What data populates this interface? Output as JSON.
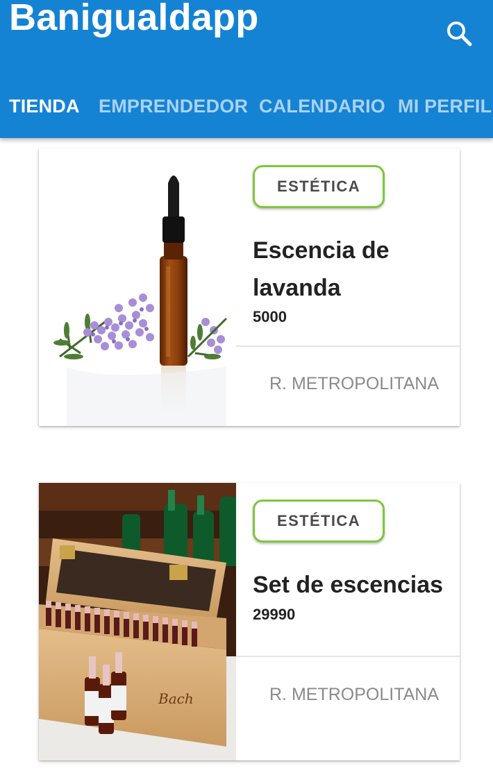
{
  "app": {
    "title": "Banigualdapp"
  },
  "header": {
    "search_icon": "search-icon"
  },
  "tabs": [
    {
      "label": "TIENDA",
      "active": true
    },
    {
      "label": "EMPRENDEDOR",
      "active": false
    },
    {
      "label": "CALENDARIO",
      "active": false
    },
    {
      "label": "MI PERFIL",
      "active": false
    }
  ],
  "colors": {
    "appbar": "#1583d3",
    "tab_inactive": "#a9d2f2",
    "badge_border": "#7dc73b"
  },
  "products": [
    {
      "category": "ESTÉTICA",
      "name": "Escencia de lavanda",
      "price": "5000",
      "location": "R. METROPOLITANA",
      "image": "lavender-essence-bottle-photo"
    },
    {
      "category": "ESTÉTICA",
      "name": "Set de escencias",
      "price": "29990",
      "location": "R. METROPOLITANA",
      "image": "bach-essences-wooden-box-photo"
    }
  ]
}
